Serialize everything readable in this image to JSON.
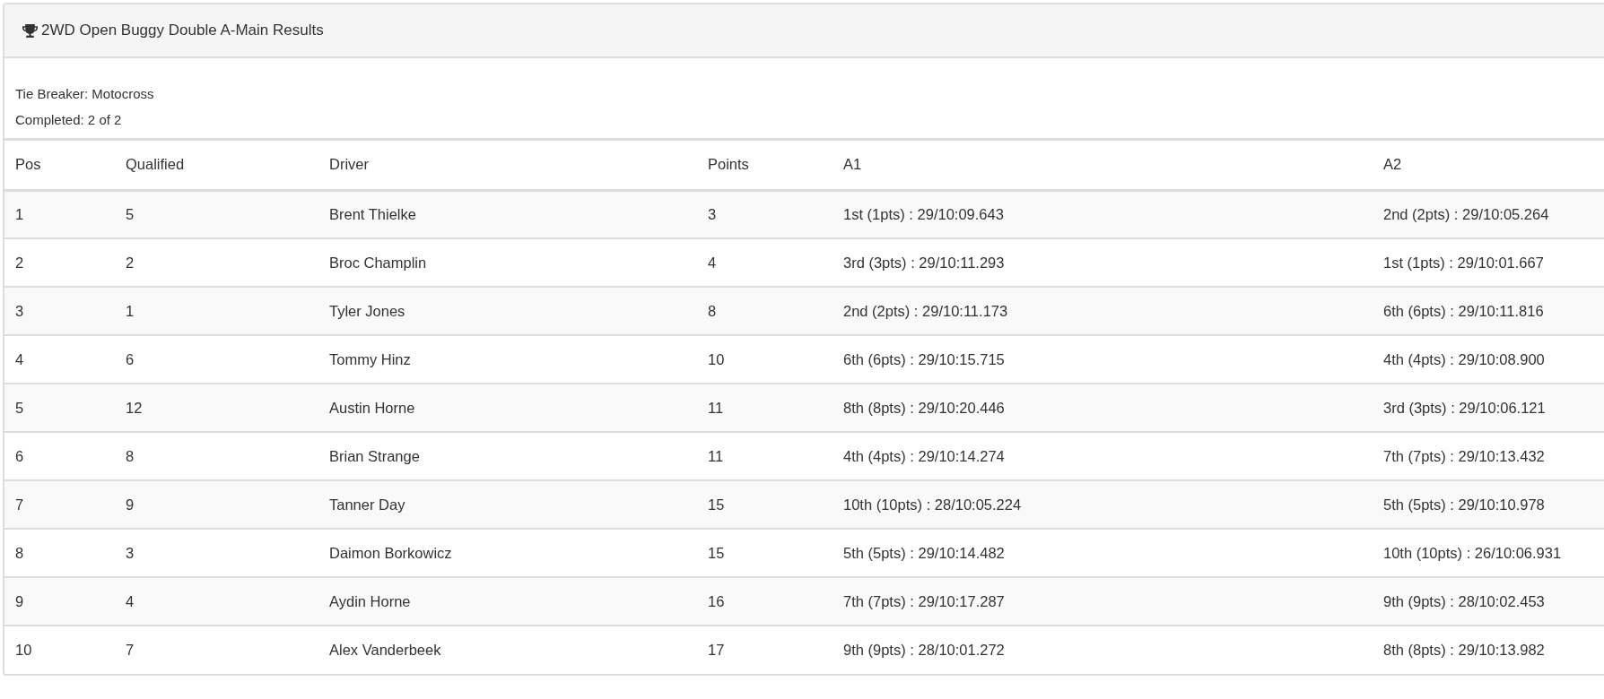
{
  "panel": {
    "title": "2WD Open Buggy Double A-Main Results"
  },
  "info": [
    "Tie Breaker: Motocross",
    "Completed: 2 of 2"
  ],
  "table": {
    "columns": [
      "Pos",
      "Qualified",
      "Driver",
      "Points",
      "A1",
      "A2"
    ],
    "rows": [
      [
        "1",
        "5",
        "Brent Thielke",
        "3",
        "1st (1pts) : 29/10:09.643",
        "2nd (2pts) : 29/10:05.264"
      ],
      [
        "2",
        "2",
        "Broc Champlin",
        "4",
        "3rd (3pts) : 29/10:11.293",
        "1st (1pts) : 29/10:01.667"
      ],
      [
        "3",
        "1",
        "Tyler Jones",
        "8",
        "2nd (2pts) : 29/10:11.173",
        "6th (6pts) : 29/10:11.816"
      ],
      [
        "4",
        "6",
        "Tommy Hinz",
        "10",
        "6th (6pts) : 29/10:15.715",
        "4th (4pts) : 29/10:08.900"
      ],
      [
        "5",
        "12",
        "Austin Horne",
        "11",
        "8th (8pts) : 29/10:20.446",
        "3rd (3pts) : 29/10:06.121"
      ],
      [
        "6",
        "8",
        "Brian Strange",
        "11",
        "4th (4pts) : 29/10:14.274",
        "7th (7pts) : 29/10:13.432"
      ],
      [
        "7",
        "9",
        "Tanner Day",
        "15",
        "10th (10pts) : 28/10:05.224",
        "5th (5pts) : 29/10:10.978"
      ],
      [
        "8",
        "3",
        "Daimon Borkowicz",
        "15",
        "5th (5pts) : 29/10:14.482",
        "10th (10pts) : 26/10:06.931"
      ],
      [
        "9",
        "4",
        "Aydin Horne",
        "16",
        "7th (7pts) : 29/10:17.287",
        "9th (9pts) : 28/10:02.453"
      ],
      [
        "10",
        "7",
        "Alex Vanderbeek",
        "17",
        "9th (9pts) : 28/10:01.272",
        "8th (8pts) : 29/10:13.982"
      ]
    ]
  }
}
